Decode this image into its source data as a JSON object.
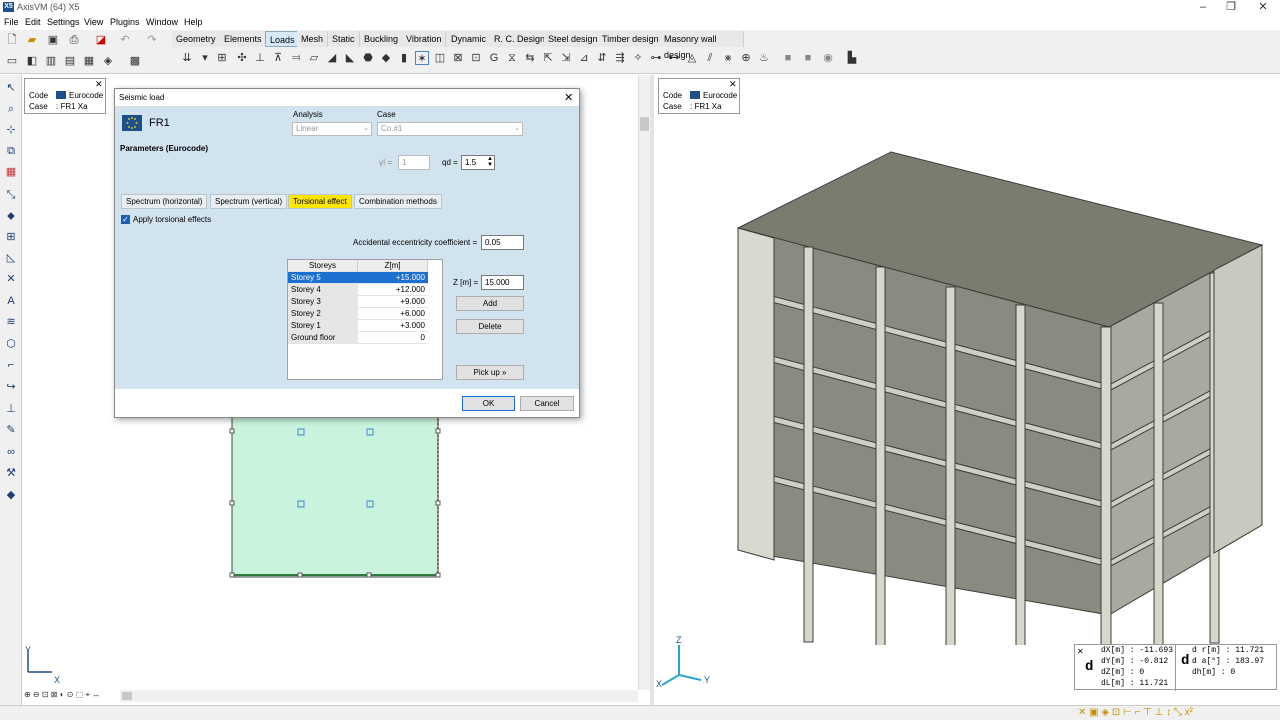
{
  "window": {
    "title": "AxisVM (64) X5",
    "logo": "X5"
  },
  "menu": [
    "File",
    "Edit",
    "Settings",
    "View",
    "Plugins",
    "Window",
    "Help"
  ],
  "tabs": [
    "Geometry",
    "Elements",
    "Loads",
    "Mesh",
    "Static",
    "Buckling",
    "Vibration",
    "Dynamic",
    "R. C. Design",
    "Steel design",
    "Timber design",
    "Masonry wall design"
  ],
  "active_tab": "Loads",
  "left_info": {
    "code_label": "Code",
    "code_value": "Eurocode",
    "case_label": "Case",
    "case_value": ": FR1 Xa"
  },
  "right_info": {
    "code_label": "Code",
    "code_value": "Eurocode",
    "case_label": "Case",
    "case_value": ": FR1 Xa"
  },
  "dialog": {
    "title": "Seismic load",
    "name": "FR1",
    "analysis_label": "Analysis",
    "analysis_value": "Linear",
    "case_label": "Case",
    "case_value": "Co.#1",
    "params_label": "Parameters (Eurocode)",
    "gamma_label": "γI =",
    "gamma_value": "1",
    "qd_label": "qd =",
    "qd_value": "1.5",
    "tabs": [
      "Spectrum (horizontal)",
      "Spectrum (vertical)",
      "Torsional effect",
      "Combination methods"
    ],
    "active_tab": "Torsional effect",
    "apply_label": "Apply torsional effects",
    "apply_checked": true,
    "ecc_label": "Accidental eccentricity coefficient =",
    "ecc_value": "0.05",
    "table": {
      "headers": [
        "Storeys",
        "Z[m]"
      ],
      "rows": [
        {
          "name": "Storey 5",
          "z": "+15.000"
        },
        {
          "name": "Storey 4",
          "z": "+12.000"
        },
        {
          "name": "Storey 3",
          "z": "+9.000"
        },
        {
          "name": "Storey 2",
          "z": "+6.000"
        },
        {
          "name": "Storey 1",
          "z": "+3.000"
        },
        {
          "name": "Ground floor",
          "z": "0"
        }
      ],
      "selected": 0
    },
    "z_label": "Z [m] =",
    "z_value": "15.000",
    "add_label": "Add",
    "delete_label": "Delete",
    "pickup_label": "Pick up »",
    "ok_label": "OK",
    "cancel_label": "Cancel"
  },
  "left_axes": {
    "y": "Y",
    "x": "X"
  },
  "right_axes": {
    "z": "Z",
    "x": "X",
    "y": "Y"
  },
  "coords": {
    "dx": "dX[m] : -11.693",
    "dy": "dY[m] : -0.812",
    "dz": "dZ[m] : 0",
    "dl": "dL[m] : 11.721",
    "dr": "d r[m] : 11.721",
    "da": "d a[°] : 183.97",
    "dh": "dh[m] : 0",
    "d1": "d",
    "d2": "d"
  },
  "colors": {
    "accent": "#1d4f8a",
    "active_tab": "#ffe600",
    "dialog_body": "#d2e3f0",
    "building": "#7b7b70",
    "plan_fill": "#c9f3dc"
  },
  "icons": [
    "new-file-icon",
    "open-folder-icon",
    "save-icon",
    "print-icon",
    "pdf-icon",
    "undo-icon",
    "redo-icon",
    "close-icon",
    "checkbox-checked-icon",
    "flag-eu-icon"
  ]
}
